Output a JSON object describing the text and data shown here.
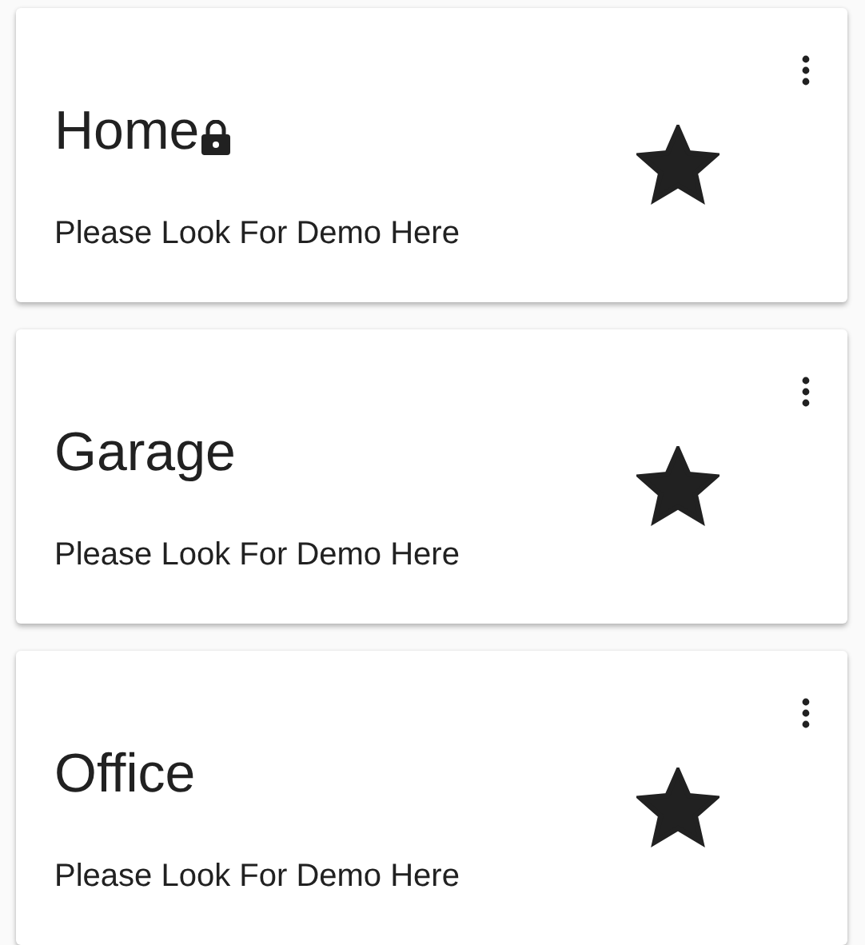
{
  "cards": [
    {
      "title": "Home",
      "locked": true,
      "subtitle": "Please Look For Demo Here",
      "favorite": true
    },
    {
      "title": "Garage",
      "locked": false,
      "subtitle": "Please Look For Demo Here",
      "favorite": true
    },
    {
      "title": "Office",
      "locked": false,
      "subtitle": "Please Look For Demo Here",
      "favorite": true
    }
  ]
}
